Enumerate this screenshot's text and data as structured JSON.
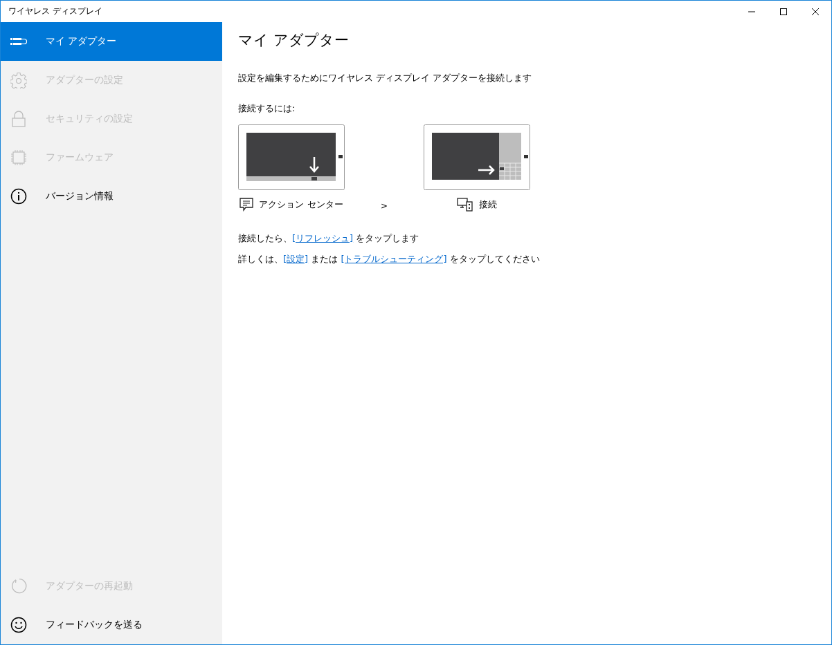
{
  "window": {
    "title": "ワイヤレス ディスプレイ"
  },
  "nav": {
    "items": [
      {
        "kind": "adapter",
        "label": "マイ アダプター",
        "selected": true,
        "disabled": false
      },
      {
        "kind": "gear",
        "label": "アダプターの設定",
        "selected": false,
        "disabled": true
      },
      {
        "kind": "lock",
        "label": "セキュリティの設定",
        "selected": false,
        "disabled": true
      },
      {
        "kind": "chip",
        "label": "ファームウェア",
        "selected": false,
        "disabled": true
      },
      {
        "kind": "info",
        "label": "バージョン情報",
        "selected": false,
        "disabled": false
      }
    ],
    "footer_items": [
      {
        "kind": "restart",
        "label": "アダプターの再起動",
        "selected": false,
        "disabled": true
      },
      {
        "kind": "smiley",
        "label": "フィードバックを送る",
        "selected": false,
        "disabled": false
      }
    ]
  },
  "content": {
    "heading": "マイ アダプター",
    "intro": "設定を編集するためにワイヤレス ディスプレイ アダプターを接続します",
    "how_to": "接続するには:",
    "steps": [
      {
        "kind": "action-center",
        "label": "アクション センター"
      },
      {
        "kind": "connect",
        "label": "接続"
      }
    ],
    "step_separator": ">",
    "lines": [
      {
        "parts": [
          {
            "text": "接続したら、",
            "link": false
          },
          {
            "text": "[リフレッシュ]",
            "link": true
          },
          {
            "text": " をタップします",
            "link": false
          }
        ]
      },
      {
        "parts": [
          {
            "text": "詳しくは、",
            "link": false
          },
          {
            "text": "[設定]",
            "link": true
          },
          {
            "text": " または ",
            "link": false
          },
          {
            "text": "[トラブルシューティング]",
            "link": true
          },
          {
            "text": " をタップしてください",
            "link": false
          }
        ]
      }
    ]
  }
}
